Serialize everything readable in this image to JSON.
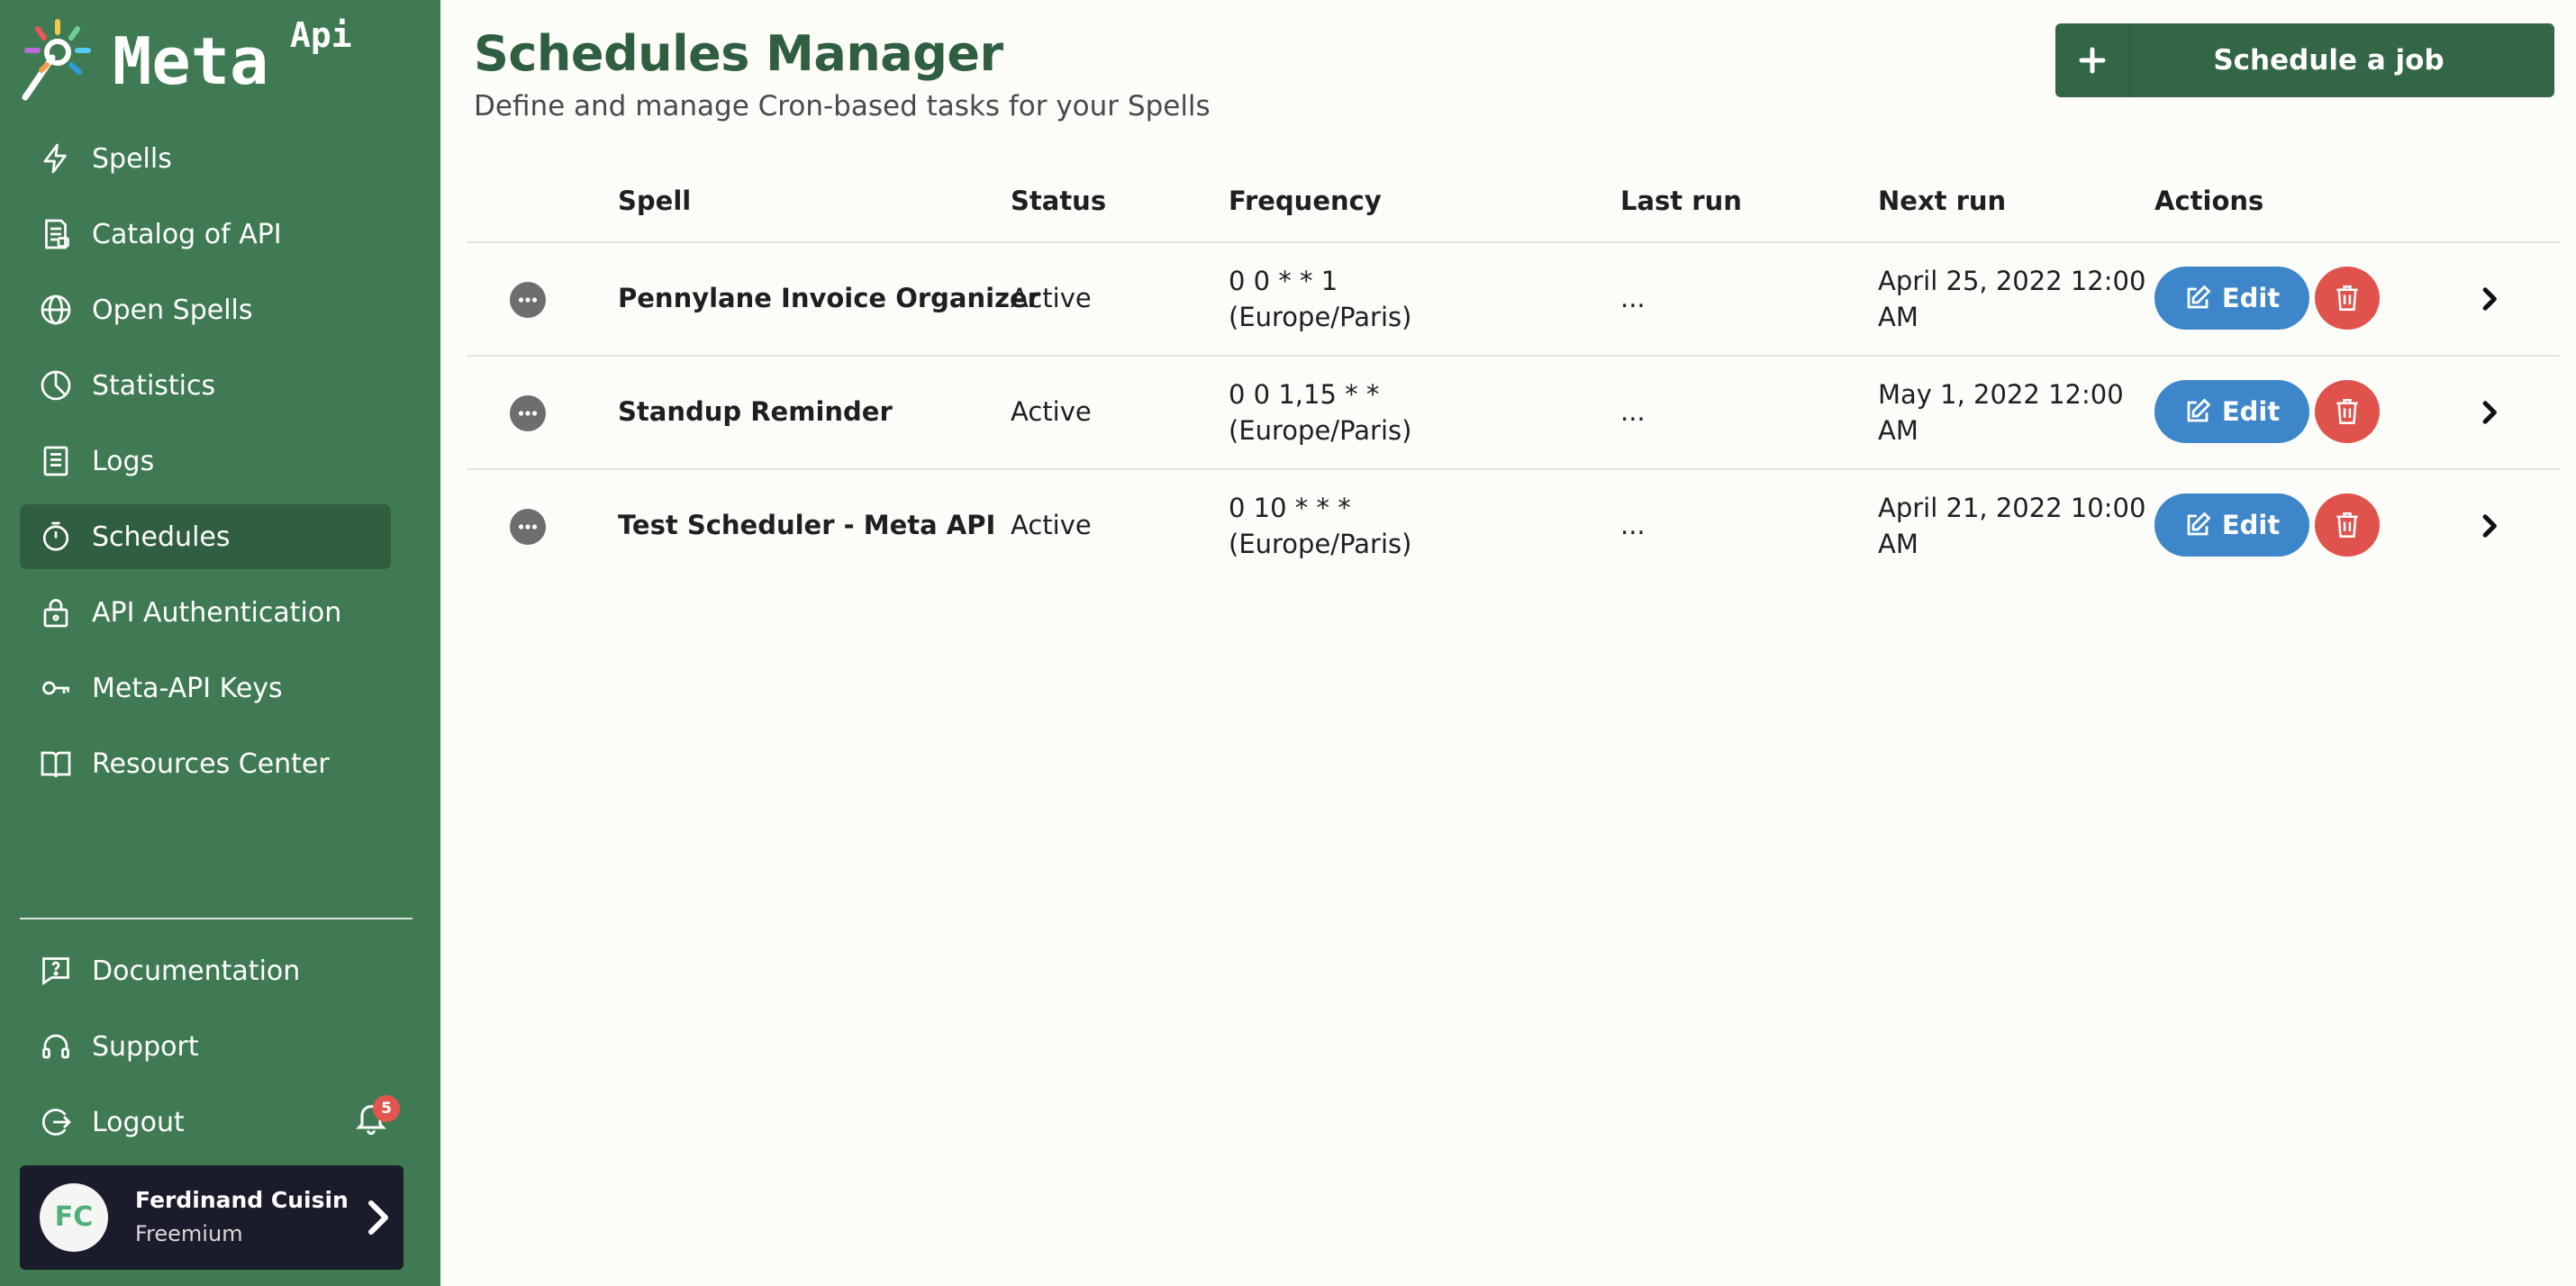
{
  "brand": {
    "name": "Meta",
    "superscript": "Api"
  },
  "sidebar": {
    "items": [
      {
        "label": "Spells",
        "icon": "lightning-icon"
      },
      {
        "label": "Catalog of API",
        "icon": "catalog-icon"
      },
      {
        "label": "Open Spells",
        "icon": "globe-icon"
      },
      {
        "label": "Statistics",
        "icon": "pie-chart-icon"
      },
      {
        "label": "Logs",
        "icon": "document-icon"
      },
      {
        "label": "Schedules",
        "icon": "stopwatch-icon",
        "active": true
      },
      {
        "label": "API Authentication",
        "icon": "lock-icon"
      },
      {
        "label": "Meta-API Keys",
        "icon": "key-icon"
      },
      {
        "label": "Resources Center",
        "icon": "book-icon"
      }
    ],
    "bottom_items": [
      {
        "label": "Documentation",
        "icon": "help-icon"
      },
      {
        "label": "Support",
        "icon": "headset-icon"
      },
      {
        "label": "Logout",
        "icon": "logout-icon"
      }
    ],
    "notifications_count": "5",
    "user": {
      "initials": "FC",
      "name": "Ferdinand Cuisin",
      "plan": "Freemium"
    }
  },
  "header": {
    "title": "Schedules Manager",
    "subtitle": "Define and manage Cron-based tasks for your Spells",
    "schedule_button": "Schedule a job"
  },
  "table": {
    "columns": [
      "Spell",
      "Status",
      "Frequency",
      "Last run",
      "Next run",
      "Actions"
    ],
    "edit_label": "Edit",
    "rows": [
      {
        "spell": "Pennylane Invoice Organizer",
        "status": "Active",
        "frequency_1": "0 0 * * 1",
        "frequency_2": "(Europe/Paris)",
        "last_run": "...",
        "next_run_1": "April 25, 2022 12:00",
        "next_run_2": "AM"
      },
      {
        "spell": "Standup Reminder",
        "status": "Active",
        "frequency_1": "0 0 1,15 * *",
        "frequency_2": "(Europe/Paris)",
        "last_run": "...",
        "next_run_1": "May 1, 2022 12:00",
        "next_run_2": "AM"
      },
      {
        "spell": "Test Scheduler - Meta API",
        "status": "Active",
        "frequency_1": "0 10 * * *",
        "frequency_2": "(Europe/Paris)",
        "last_run": "...",
        "next_run_1": "April 21, 2022 10:00",
        "next_run_2": "AM"
      }
    ]
  },
  "colors": {
    "sidebar": "#3f7a52",
    "sidebar_active": "#2f5e40",
    "title": "#2f5e40",
    "edit": "#3d86c9",
    "delete": "#e0534d",
    "badge": "#e0574f"
  }
}
